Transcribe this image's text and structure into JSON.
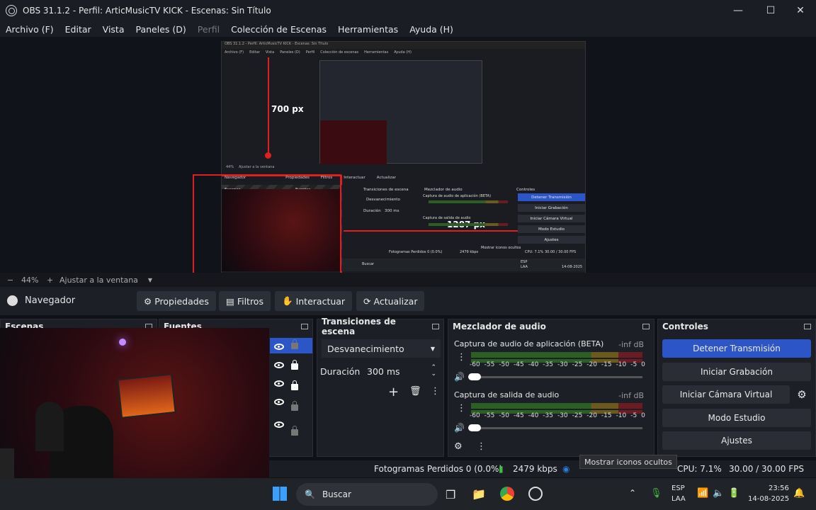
{
  "titlebar": {
    "title": "OBS 31.1.2 - Perfil: ArticMusicTV KICK - Escenas: Sin Título",
    "minimize": "—",
    "maximize": "☐",
    "close": "✕"
  },
  "menu": [
    "Archivo (F)",
    "Editar",
    "Vista",
    "Paneles (D)",
    "Perfil",
    "Colección de Escenas",
    "Herramientas",
    "Ayuda (H)"
  ],
  "preview": {
    "label_700": "700 px",
    "label_1287": "1287 px",
    "inner_title": "OBS 31.1.2 - Perfil: ArticMusicTV KICK - Escenas: Sin Título",
    "inner_menu": [
      "Archivo (F)",
      "Editar",
      "Vista",
      "Paneles (D)",
      "Perfil",
      "Colección de escenas",
      "Herramientas",
      "Ayuda (H)"
    ],
    "inner_nav": [
      "Navegador",
      "Propiedades",
      "Filtros",
      "Interactuar",
      "Actualizar"
    ],
    "inner_docks": [
      "Escenas",
      "Fuentes",
      "Transiciones de escena",
      "Mezclador de audio",
      "Controles"
    ],
    "inner_transition": "Desvanecimiento",
    "inner_duration_label": "Duración",
    "inner_duration": "300 ms",
    "inner_audio1": "Captura de audio de aplicación (BETA)",
    "inner_audio2": "Captura de salida de audio",
    "inner_controls": [
      "Detener Transmisión",
      "Iniciar Grabación",
      "Iniciar Cámara Virtual",
      "Modo Estudio",
      "Ajustes"
    ],
    "inner_status": "Fotogramas Perdidos 0 (0.0%)",
    "inner_kbps": "2479 kbps",
    "inner_cpu": "CPU: 7.1%",
    "inner_fps": "30.00 / 30.00 FPS",
    "inner_tooltip": "Mostrar iconos ocultos",
    "inner_search": "Buscar",
    "inner_zoom": "44%",
    "inner_fit": "Ajustar a la ventana",
    "inner_lang": "ESP",
    "inner_lang2": "LAA",
    "inner_time": "14-08-2025"
  },
  "zoom": {
    "minus": "−",
    "value": "44%",
    "plus": "+",
    "fit": "Ajustar a la ventana"
  },
  "nav": {
    "label": "Navegador",
    "propiedades": "Propiedades",
    "filtros": "Filtros",
    "interactuar": "Interactuar",
    "actualizar": "Actualizar"
  },
  "docks": {
    "escenas": "Escenas",
    "fuentes": "Fuentes",
    "transiciones": "Transiciones de escena",
    "transition_value": "Desvanecimiento",
    "duration_label": "Duración",
    "duration_value": "300 ms",
    "mezclador": "Mezclador de audio",
    "audio1_name": "Captura de audio de aplicación (BETA)",
    "audio1_level": "-inf dB",
    "audio2_name": "Captura de salida de audio",
    "audio2_level": "-inf dB",
    "scale": [
      "-60",
      "-55",
      "-50",
      "-45",
      "-40",
      "-35",
      "-30",
      "-25",
      "-20",
      "-15",
      "-10",
      "-5",
      "0"
    ],
    "controles": "Controles",
    "ctrl": [
      "Detener Transmisión",
      "Iniciar Grabación",
      "Iniciar Cámara Virtual",
      "Modo Estudio",
      "Ajustes"
    ]
  },
  "status": {
    "frames": "Fotogramas Perdidos 0 (0.0%)",
    "kbps": "2479 kbps",
    "cpu": "CPU: 7.1%",
    "fps": "30.00 / 30.00 FPS",
    "tooltip": "Mostrar iconos ocultos"
  },
  "taskbar": {
    "search": "Buscar",
    "lang": "ESP",
    "lang2": "LAA",
    "time": "23:56",
    "date": "14-08-2025"
  },
  "colors": {
    "accent": "#2c56c7",
    "red": "#e02020"
  }
}
